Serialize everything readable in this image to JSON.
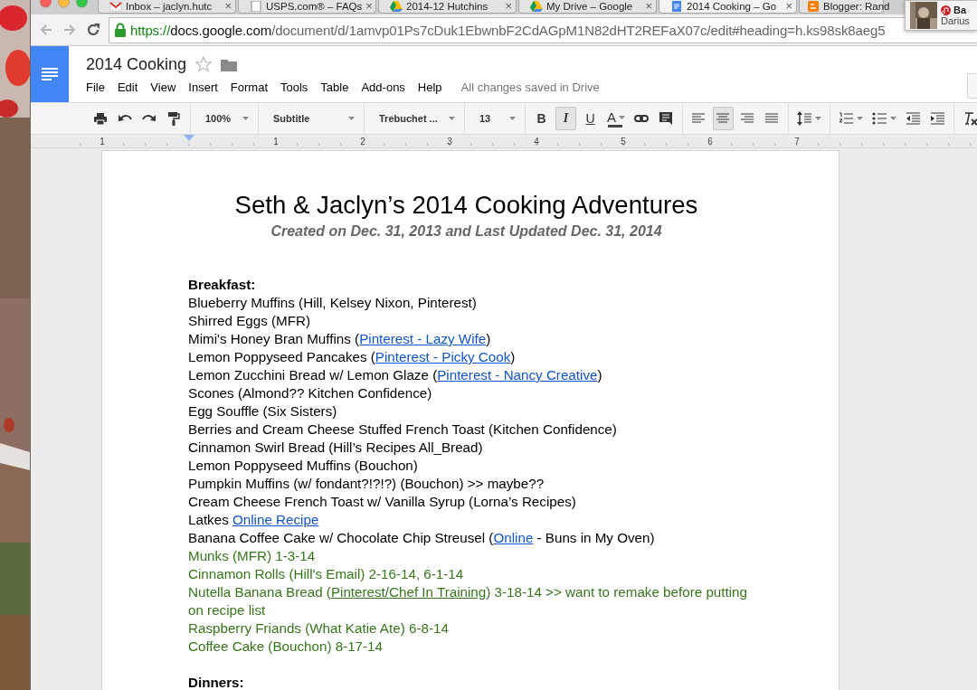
{
  "tabs": [
    {
      "title": "Inbox – jaclyn.hutc",
      "close": "×",
      "selected": false
    },
    {
      "title": "USPS.com® – FAQs",
      "close": "×",
      "selected": false
    },
    {
      "title": "2014-12 Hutchins",
      "close": "×",
      "selected": false
    },
    {
      "title": "My Drive – Google",
      "close": "×",
      "selected": false
    },
    {
      "title": "2014 Cooking – Go",
      "close": "×",
      "selected": true
    },
    {
      "title": "Blogger: Rand",
      "selected": false
    }
  ],
  "notification": {
    "title": "Ba",
    "subtitle": "Darius"
  },
  "address_bar": {
    "scheme": "https://",
    "host": "docs.google.com",
    "path": "/document/d/1amvp01Ps7cDuk1EbwnbF2CdAGpM1N82dHT2REFaX07c/edit#heading=h.ks98sk8aeg5"
  },
  "document": {
    "title": "2014 Cooking",
    "starred": false,
    "status": "All changes saved in Drive"
  },
  "menu": [
    "File",
    "Edit",
    "View",
    "Insert",
    "Format",
    "Tools",
    "Table",
    "Add-ons",
    "Help"
  ],
  "toolbar": [
    {
      "items": [
        {
          "kind": "icon"
        },
        {
          "kind": "icon"
        },
        {
          "kind": "icon"
        },
        {
          "kind": "icon"
        }
      ]
    },
    {
      "items": [
        {
          "kind": "dropdown",
          "label": "100%"
        }
      ]
    },
    {
      "items": [
        {
          "kind": "dropdown",
          "label": "Subtitle"
        }
      ]
    },
    {
      "items": [
        {
          "kind": "dropdown",
          "label": "Trebuchet ..."
        }
      ]
    },
    {
      "items": [
        {
          "kind": "dropdown",
          "label": "13"
        }
      ]
    },
    {
      "items": [
        {
          "kind": "letter",
          "label": "B",
          "selected": false
        },
        {
          "kind": "letter",
          "label": "I",
          "selected": true
        },
        {
          "kind": "letter",
          "label": "U",
          "selected": false
        },
        {
          "kind": "color",
          "label": "A",
          "color": "#444444"
        },
        {
          "kind": "icon"
        },
        {
          "kind": "icon"
        }
      ]
    },
    {
      "items": [
        {
          "kind": "icon",
          "selected": false
        },
        {
          "kind": "icon",
          "selected": true
        },
        {
          "kind": "icon",
          "selected": false
        },
        {
          "kind": "icon",
          "selected": false
        }
      ]
    },
    {
      "items": [
        {
          "kind": "icon"
        }
      ]
    },
    {
      "items": [
        {
          "kind": "icon"
        },
        {
          "kind": "icon"
        },
        {
          "kind": "icon"
        },
        {
          "kind": "icon"
        }
      ]
    },
    {
      "items": [
        {
          "kind": "icon"
        }
      ]
    }
  ],
  "ruler": [
    "1",
    "1",
    "2",
    "3",
    "4",
    "5",
    "6",
    "7"
  ],
  "page": {
    "title": "Seth & Jaclyn’s 2014 Cooking Adventures",
    "subtitle": "Created on Dec. 31, 2013 and Last Updated Dec. 31, 2014",
    "lines": [
      {
        "kind": "heading",
        "color": "#000000",
        "parts": [
          {
            "text": "Breakfast:"
          }
        ]
      },
      {
        "kind": "item",
        "color": "#000000",
        "parts": [
          {
            "text": "Blueberry Muffins (Hill, Kelsey Nixon, Pinterest)"
          }
        ]
      },
      {
        "kind": "item",
        "color": "#000000",
        "parts": [
          {
            "text": "Shirred Eggs (MFR)"
          }
        ]
      },
      {
        "kind": "item",
        "color": "#000000",
        "parts": [
          {
            "text": "Mimi's Honey Bran Muffins ("
          },
          {
            "text": "Pinterest - Lazy Wife",
            "link": true
          },
          {
            "text": ")"
          }
        ]
      },
      {
        "kind": "item",
        "color": "#000000",
        "parts": [
          {
            "text": "Lemon Poppyseed Pancakes ("
          },
          {
            "text": "Pinterest - Picky Cook",
            "link": true
          },
          {
            "text": ")"
          }
        ]
      },
      {
        "kind": "item",
        "color": "#000000",
        "parts": [
          {
            "text": "Lemon Zucchini Bread w/ Lemon Glaze ("
          },
          {
            "text": "Pinterest - Nancy Creative",
            "link": true
          },
          {
            "text": ")"
          }
        ]
      },
      {
        "kind": "item",
        "color": "#000000",
        "parts": [
          {
            "text": "Scones (Almond?? Kitchen Confidence)"
          }
        ]
      },
      {
        "kind": "item",
        "color": "#000000",
        "parts": [
          {
            "text": "Egg Souffle (Six Sisters)"
          }
        ]
      },
      {
        "kind": "item",
        "color": "#000000",
        "parts": [
          {
            "text": "Berries and Cream Cheese Stuffed French Toast (Kitchen Confidence)"
          }
        ]
      },
      {
        "kind": "item",
        "color": "#000000",
        "parts": [
          {
            "text": "Cinnamon Swirl Bread (Hill’s Recipes All_Bread)"
          }
        ]
      },
      {
        "kind": "item",
        "color": "#000000",
        "parts": [
          {
            "text": "Lemon Poppyseed Muffins (Bouchon)"
          }
        ]
      },
      {
        "kind": "item",
        "color": "#000000",
        "parts": [
          {
            "text": "Pumpkin Muffins (w/ fondant?!?!?) (Bouchon) >> maybe??"
          }
        ]
      },
      {
        "kind": "item",
        "color": "#000000",
        "parts": [
          {
            "text": "Cream Cheese French Toast w/ Vanilla Syrup (Lorna’s Recipes)"
          }
        ]
      },
      {
        "kind": "item",
        "color": "#000000",
        "parts": [
          {
            "text": "Latkes "
          },
          {
            "text": "Online Recipe",
            "link": true
          }
        ]
      },
      {
        "kind": "item",
        "color": "#000000",
        "parts": [
          {
            "text": "Banana Coffee Cake w/ Chocolate Chip Streusel ("
          },
          {
            "text": "Online",
            "link": true
          },
          {
            "text": " - Buns in My Oven)"
          }
        ]
      },
      {
        "kind": "item",
        "color": "#38761d",
        "parts": [
          {
            "text": "Munks (MFR) 1-3-14"
          }
        ]
      },
      {
        "kind": "item",
        "color": "#38761d",
        "parts": [
          {
            "text": "Cinnamon Rolls (Hill's Email) 2-16-14, 6-1-14"
          }
        ]
      },
      {
        "kind": "item",
        "color": "#38761d",
        "parts": [
          {
            "text": "Nutella Banana Bread ("
          },
          {
            "text": "Pinterest/Chef In Training",
            "link": true
          },
          {
            "text": ") 3-18-14 >> want to remake before putting on recipe list"
          }
        ]
      },
      {
        "kind": "item",
        "color": "#38761d",
        "parts": [
          {
            "text": "Raspberry Friands (What Katie Ate) 6-8-14"
          }
        ]
      },
      {
        "kind": "item",
        "color": "#38761d",
        "parts": [
          {
            "text": "Coffee Cake (Bouchon) 8-17-14"
          }
        ]
      },
      {
        "kind": "heading",
        "color": "#000000",
        "parts": [
          {
            "text": "Dinners:"
          }
        ]
      }
    ]
  }
}
